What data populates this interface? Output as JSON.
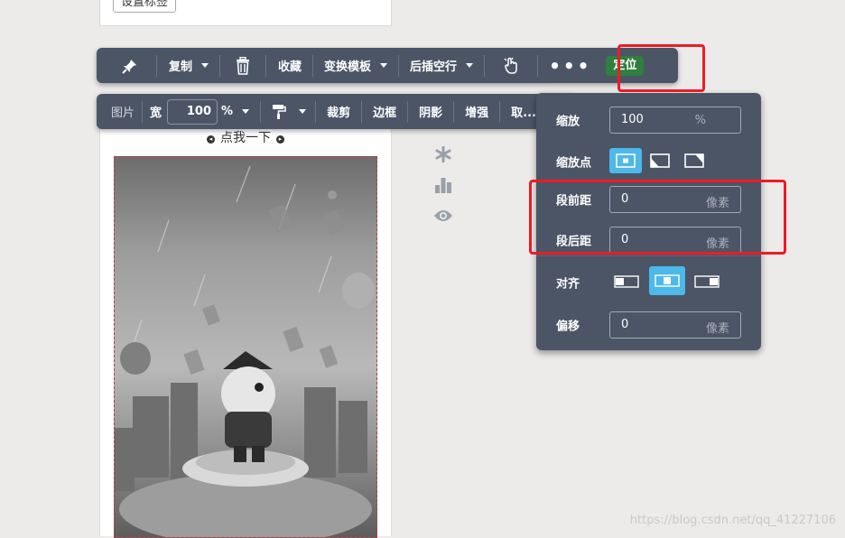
{
  "top_card": {
    "tag_button": "设置标签"
  },
  "toolbar_main": {
    "copy": "复制",
    "collect": "收藏",
    "swap_template": "变换模板",
    "insert_blank": "后插空行",
    "locate": "定位"
  },
  "toolbar_image": {
    "image": "图片",
    "width_label": "宽",
    "width_value": "100",
    "percent": "%",
    "crop": "裁剪",
    "border": "边框",
    "shadow": "阴影",
    "enhance": "增强",
    "more_clipped": "取..."
  },
  "doc": {
    "click_me": "点我一下"
  },
  "position_panel": {
    "scale_label": "缩放",
    "scale_value": "100",
    "scale_unit": "%",
    "scale_point_label": "缩放点",
    "before_label": "段前距",
    "before_value": "0",
    "before_unit": "像素",
    "after_label": "段后距",
    "after_value": "0",
    "after_unit": "像素",
    "align_label": "对齐",
    "offset_label": "偏移",
    "offset_value": "0",
    "offset_unit": "像素"
  },
  "watermark": "https://blog.csdn.net/qq_41227106",
  "colors": {
    "toolbar_bg": "#4b5566",
    "accent_blue": "#4db8ea",
    "locate_green": "#2f7f3e",
    "highlight_red": "#ee1b24"
  }
}
